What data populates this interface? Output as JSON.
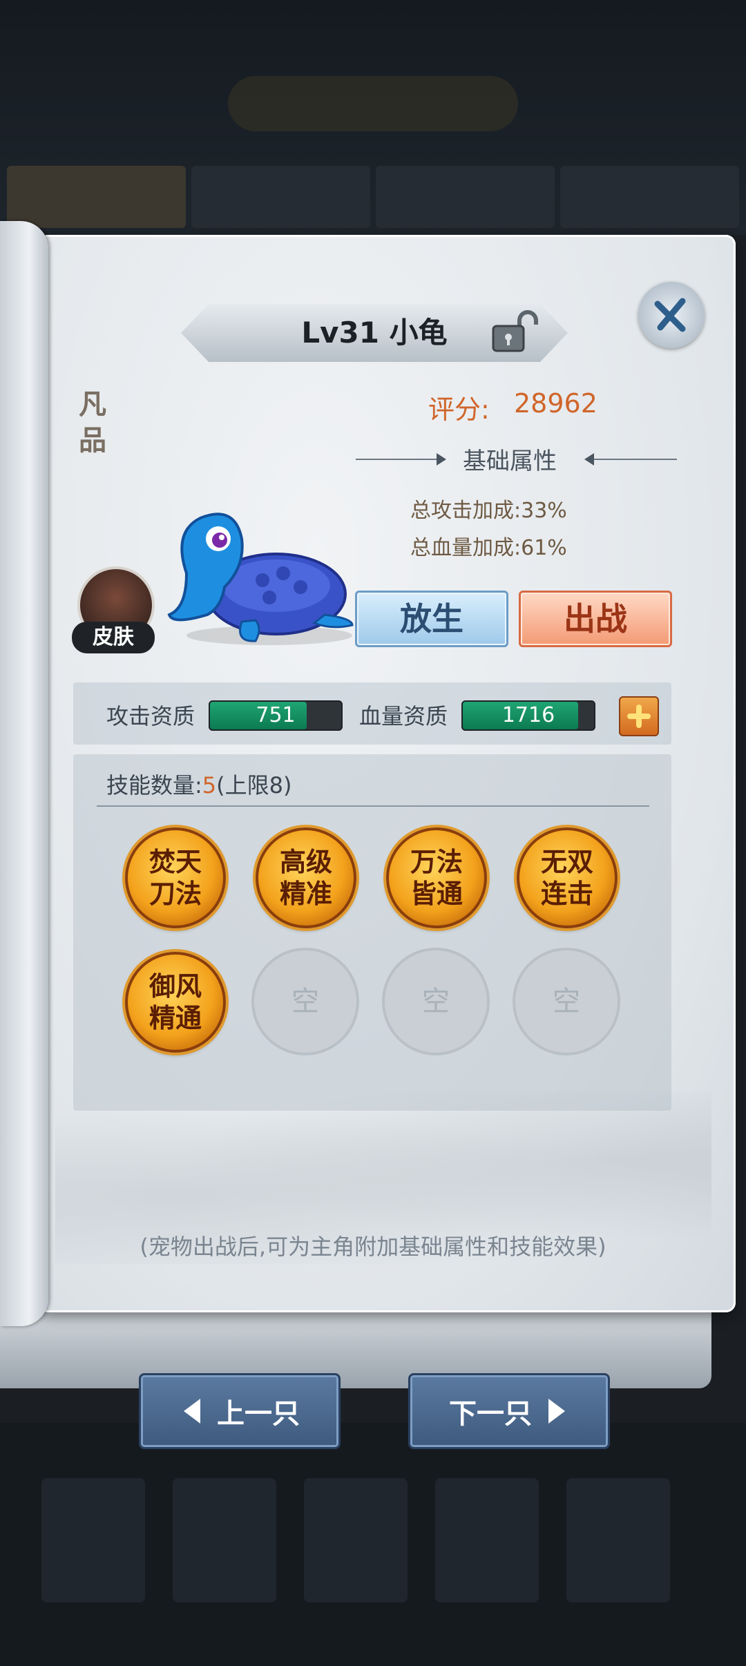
{
  "header": {
    "title": "Lv31 小龟",
    "grade": "凡品"
  },
  "score": {
    "label": "评分:",
    "value": "28962"
  },
  "base_attributes": {
    "title": "基础属性",
    "items": [
      {
        "label": "总攻击加成:",
        "value": "33%"
      },
      {
        "label": "总血量加成:",
        "value": "61%"
      }
    ]
  },
  "skin_label": "皮肤",
  "buttons": {
    "release": "放生",
    "deploy": "出战",
    "prev": "上一只",
    "next": "下一只"
  },
  "aptitude": {
    "attack": {
      "label": "攻击资质",
      "value": "751",
      "fill_fraction": 0.72
    },
    "hp": {
      "label": "血量资质",
      "value": "1716",
      "fill_fraction": 0.86
    }
  },
  "skills": {
    "count_label": "技能数量:",
    "count": "5",
    "limit": "(上限8)",
    "slots": [
      "焚天\n刀法",
      "高级\n精准",
      "万法\n皆通",
      "无双\n连击",
      "御风\n精通",
      "空",
      "空",
      "空"
    ]
  },
  "note": "(宠物出战后,可为主角附加基础属性和技能效果)",
  "colors": {
    "accent_orange": "#d0652a",
    "bar_green": "#1fa574",
    "nav_blue": "#4a6a90"
  }
}
